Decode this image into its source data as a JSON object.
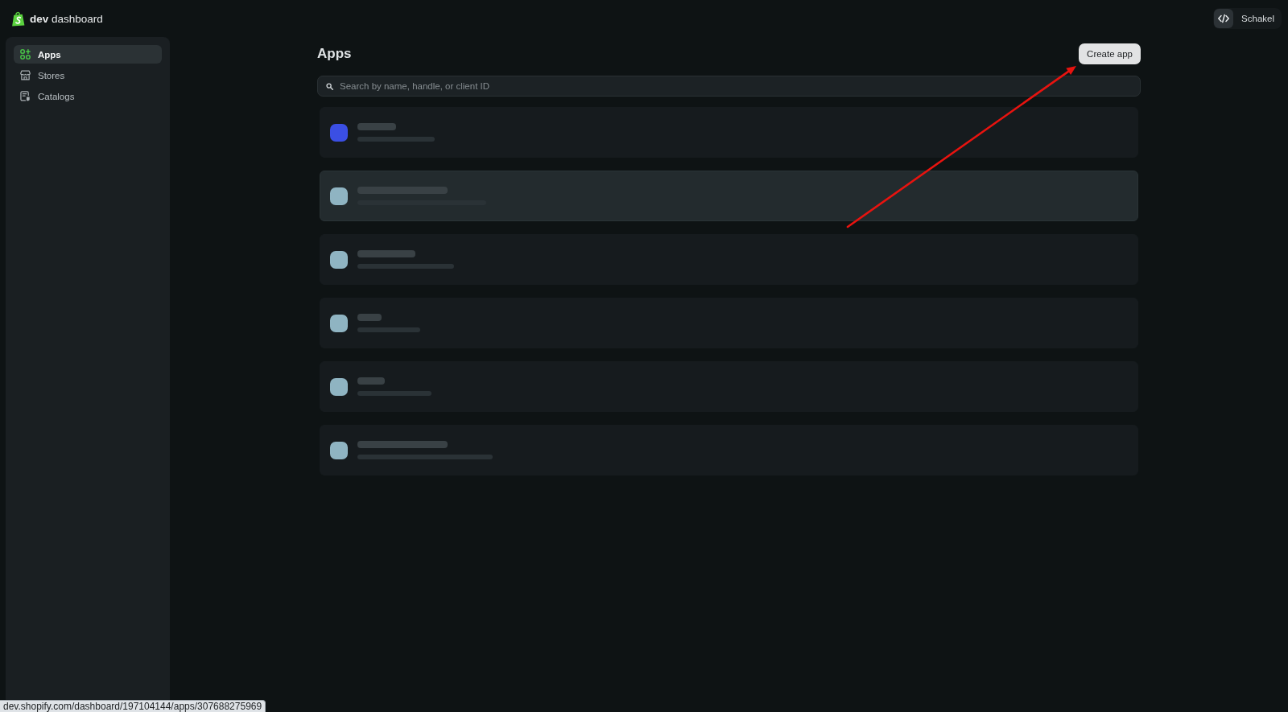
{
  "header": {
    "brand": "**dev** dashboard",
    "user_button": {
      "label": "Schakel"
    }
  },
  "sidebar": {
    "items": [
      {
        "label": "Apps",
        "selected": true
      },
      {
        "label": "Stores",
        "selected": false
      },
      {
        "label": "Catalogs",
        "selected": false
      }
    ]
  },
  "main": {
    "title": "Apps",
    "create_button": "Create app",
    "search": {
      "placeholder": "Search by name, handle, or client ID"
    },
    "app_rows": [
      {
        "color": "#3b4fe4",
        "highlighted": false
      },
      {
        "color": "#8fb4c2",
        "highlighted": true
      },
      {
        "color": "#8fb4c2",
        "highlighted": false
      },
      {
        "color": "#8fb4c2",
        "highlighted": false
      },
      {
        "color": "#8fb4c2",
        "highlighted": false
      },
      {
        "color": "#8fb4c2",
        "highlighted": false
      }
    ]
  },
  "annotation": {
    "kind": "arrow"
  },
  "status_bar": {
    "url": "dev.shopify.com/dashboard/197104144/apps/307688275969"
  }
}
